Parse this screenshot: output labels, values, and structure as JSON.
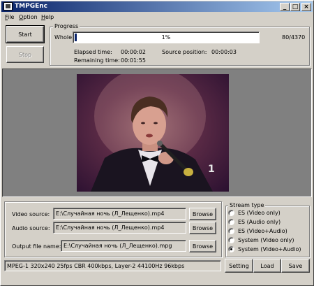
{
  "window": {
    "title": "TMPGEnc"
  },
  "titlebar_buttons": {
    "minimize": "_",
    "maximize": "□",
    "close": "×"
  },
  "menu": [
    {
      "label": "File",
      "underline": "F",
      "rest": "ile"
    },
    {
      "label": "Option",
      "underline": "O",
      "rest": "ption"
    },
    {
      "label": "Help",
      "underline": "H",
      "rest": "elp"
    }
  ],
  "controls": {
    "start_label": "Start",
    "stop_label": "Stop"
  },
  "progress": {
    "group_label": "Progress",
    "whole_label": "Whole:",
    "percent_text": "1%",
    "fraction": 0.01,
    "frames_text": "80/4370",
    "elapsed_label": "Elapsed time:",
    "elapsed_value": "00:00:02",
    "remaining_label": "Remaining time:",
    "remaining_value": "00:01:55",
    "source_position_label": "Source position:",
    "source_position_value": "00:00:03"
  },
  "sources": {
    "video_label": "Video source:",
    "video_value": "E:\\Случайная ночь (Л_Лещенко).mp4",
    "audio_label": "Audio source:",
    "audio_value": "E:\\Случайная ночь (Л_Лещенко).mp4",
    "output_label": "Output file name:",
    "output_value": "E:\\Случайная ночь (Л_Лещенко).mpg",
    "browse_label": "Browse"
  },
  "stream_type": {
    "label": "Stream type",
    "options": [
      {
        "label": "ES (Video only)",
        "checked": false
      },
      {
        "label": "ES (Audio only)",
        "checked": false
      },
      {
        "label": "ES (Video+Audio)",
        "checked": false
      },
      {
        "label": "System (Video only)",
        "checked": false
      },
      {
        "label": "System (Video+Audio)",
        "checked": true
      }
    ]
  },
  "status": {
    "text": "MPEG-1 320x240 25fps CBR 400kbps,  Layer-2 44100Hz 96kbps",
    "setting_label": "Setting",
    "load_label": "Load",
    "save_label": "Save"
  },
  "preview": {
    "overlay_logo": "1"
  }
}
